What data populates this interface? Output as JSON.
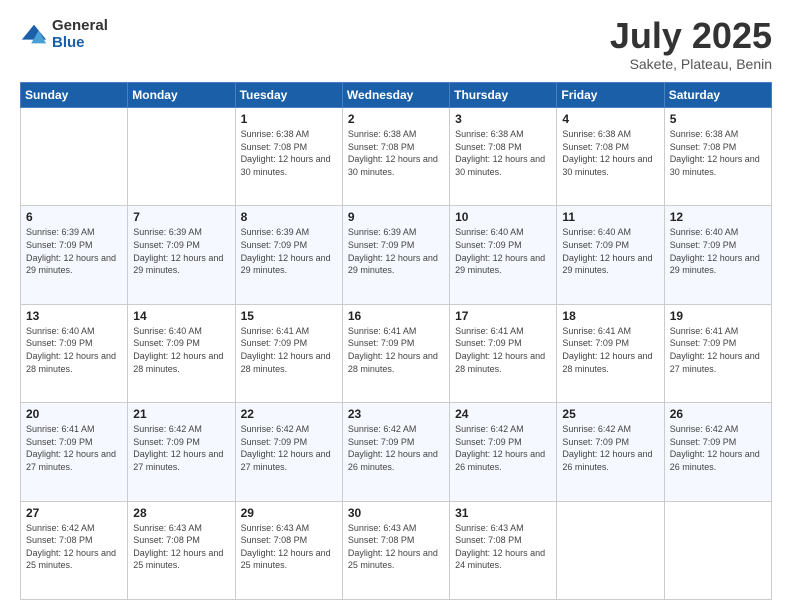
{
  "logo": {
    "general": "General",
    "blue": "Blue"
  },
  "header": {
    "month": "July 2025",
    "location": "Sakete, Plateau, Benin"
  },
  "weekdays": [
    "Sunday",
    "Monday",
    "Tuesday",
    "Wednesday",
    "Thursday",
    "Friday",
    "Saturday"
  ],
  "weeks": [
    [
      {
        "day": "",
        "info": ""
      },
      {
        "day": "",
        "info": ""
      },
      {
        "day": "1",
        "info": "Sunrise: 6:38 AM\nSunset: 7:08 PM\nDaylight: 12 hours and 30 minutes."
      },
      {
        "day": "2",
        "info": "Sunrise: 6:38 AM\nSunset: 7:08 PM\nDaylight: 12 hours and 30 minutes."
      },
      {
        "day": "3",
        "info": "Sunrise: 6:38 AM\nSunset: 7:08 PM\nDaylight: 12 hours and 30 minutes."
      },
      {
        "day": "4",
        "info": "Sunrise: 6:38 AM\nSunset: 7:08 PM\nDaylight: 12 hours and 30 minutes."
      },
      {
        "day": "5",
        "info": "Sunrise: 6:38 AM\nSunset: 7:08 PM\nDaylight: 12 hours and 30 minutes."
      }
    ],
    [
      {
        "day": "6",
        "info": "Sunrise: 6:39 AM\nSunset: 7:09 PM\nDaylight: 12 hours and 29 minutes."
      },
      {
        "day": "7",
        "info": "Sunrise: 6:39 AM\nSunset: 7:09 PM\nDaylight: 12 hours and 29 minutes."
      },
      {
        "day": "8",
        "info": "Sunrise: 6:39 AM\nSunset: 7:09 PM\nDaylight: 12 hours and 29 minutes."
      },
      {
        "day": "9",
        "info": "Sunrise: 6:39 AM\nSunset: 7:09 PM\nDaylight: 12 hours and 29 minutes."
      },
      {
        "day": "10",
        "info": "Sunrise: 6:40 AM\nSunset: 7:09 PM\nDaylight: 12 hours and 29 minutes."
      },
      {
        "day": "11",
        "info": "Sunrise: 6:40 AM\nSunset: 7:09 PM\nDaylight: 12 hours and 29 minutes."
      },
      {
        "day": "12",
        "info": "Sunrise: 6:40 AM\nSunset: 7:09 PM\nDaylight: 12 hours and 29 minutes."
      }
    ],
    [
      {
        "day": "13",
        "info": "Sunrise: 6:40 AM\nSunset: 7:09 PM\nDaylight: 12 hours and 28 minutes."
      },
      {
        "day": "14",
        "info": "Sunrise: 6:40 AM\nSunset: 7:09 PM\nDaylight: 12 hours and 28 minutes."
      },
      {
        "day": "15",
        "info": "Sunrise: 6:41 AM\nSunset: 7:09 PM\nDaylight: 12 hours and 28 minutes."
      },
      {
        "day": "16",
        "info": "Sunrise: 6:41 AM\nSunset: 7:09 PM\nDaylight: 12 hours and 28 minutes."
      },
      {
        "day": "17",
        "info": "Sunrise: 6:41 AM\nSunset: 7:09 PM\nDaylight: 12 hours and 28 minutes."
      },
      {
        "day": "18",
        "info": "Sunrise: 6:41 AM\nSunset: 7:09 PM\nDaylight: 12 hours and 28 minutes."
      },
      {
        "day": "19",
        "info": "Sunrise: 6:41 AM\nSunset: 7:09 PM\nDaylight: 12 hours and 27 minutes."
      }
    ],
    [
      {
        "day": "20",
        "info": "Sunrise: 6:41 AM\nSunset: 7:09 PM\nDaylight: 12 hours and 27 minutes."
      },
      {
        "day": "21",
        "info": "Sunrise: 6:42 AM\nSunset: 7:09 PM\nDaylight: 12 hours and 27 minutes."
      },
      {
        "day": "22",
        "info": "Sunrise: 6:42 AM\nSunset: 7:09 PM\nDaylight: 12 hours and 27 minutes."
      },
      {
        "day": "23",
        "info": "Sunrise: 6:42 AM\nSunset: 7:09 PM\nDaylight: 12 hours and 26 minutes."
      },
      {
        "day": "24",
        "info": "Sunrise: 6:42 AM\nSunset: 7:09 PM\nDaylight: 12 hours and 26 minutes."
      },
      {
        "day": "25",
        "info": "Sunrise: 6:42 AM\nSunset: 7:09 PM\nDaylight: 12 hours and 26 minutes."
      },
      {
        "day": "26",
        "info": "Sunrise: 6:42 AM\nSunset: 7:09 PM\nDaylight: 12 hours and 26 minutes."
      }
    ],
    [
      {
        "day": "27",
        "info": "Sunrise: 6:42 AM\nSunset: 7:08 PM\nDaylight: 12 hours and 25 minutes."
      },
      {
        "day": "28",
        "info": "Sunrise: 6:43 AM\nSunset: 7:08 PM\nDaylight: 12 hours and 25 minutes."
      },
      {
        "day": "29",
        "info": "Sunrise: 6:43 AM\nSunset: 7:08 PM\nDaylight: 12 hours and 25 minutes."
      },
      {
        "day": "30",
        "info": "Sunrise: 6:43 AM\nSunset: 7:08 PM\nDaylight: 12 hours and 25 minutes."
      },
      {
        "day": "31",
        "info": "Sunrise: 6:43 AM\nSunset: 7:08 PM\nDaylight: 12 hours and 24 minutes."
      },
      {
        "day": "",
        "info": ""
      },
      {
        "day": "",
        "info": ""
      }
    ]
  ]
}
